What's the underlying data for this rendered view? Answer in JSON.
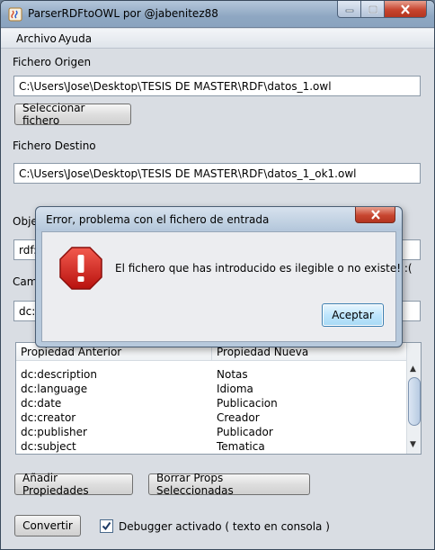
{
  "window": {
    "title": "ParserRDFtoOWL por @jabenitez88"
  },
  "menu": {
    "items": [
      "Archivo",
      "Ayuda"
    ]
  },
  "origen": {
    "label": "Fichero Origen",
    "value": "C:\\Users\\Jose\\Desktop\\TESIS DE MASTER\\RDF\\datos_1.owl",
    "select_button": "Seleccionar fichero"
  },
  "destino": {
    "label": "Fichero Destino",
    "value": "C:\\Users\\Jose\\Desktop\\TESIS DE MASTER\\RDF\\datos_1_ok1.owl"
  },
  "objeto": {
    "label_partial": "Obje",
    "value_partial": "rdf:D"
  },
  "campo": {
    "label_partial": "Cam",
    "value_partial": "dc:i"
  },
  "table": {
    "headers": [
      "Propiedad Anterior",
      "Propiedad Nueva"
    ],
    "rows": [
      [
        "dc:description",
        "Notas"
      ],
      [
        "dc:language",
        "Idioma"
      ],
      [
        "dc:date",
        "Publicacion"
      ],
      [
        "dc:creator",
        "Creador"
      ],
      [
        "dc:publisher",
        "Publicador"
      ],
      [
        "dc:subject",
        "Tematica"
      ]
    ]
  },
  "buttons": {
    "add_props": "Añadir Propiedades",
    "delete_props": "Borrar Props Seleccionadas",
    "convert": "Convertir"
  },
  "debugger": {
    "label": "Debugger activado ( texto en consola )",
    "checked": true
  },
  "dialog": {
    "title": "Error, problema con el fichero de entrada",
    "message": "El fichero que has introducido es ilegible o no existe! :(",
    "accept": "Aceptar",
    "icon": "error-icon"
  },
  "colors": {
    "error_red": "#d8201c",
    "accent_blue": "#3c7fb1"
  }
}
